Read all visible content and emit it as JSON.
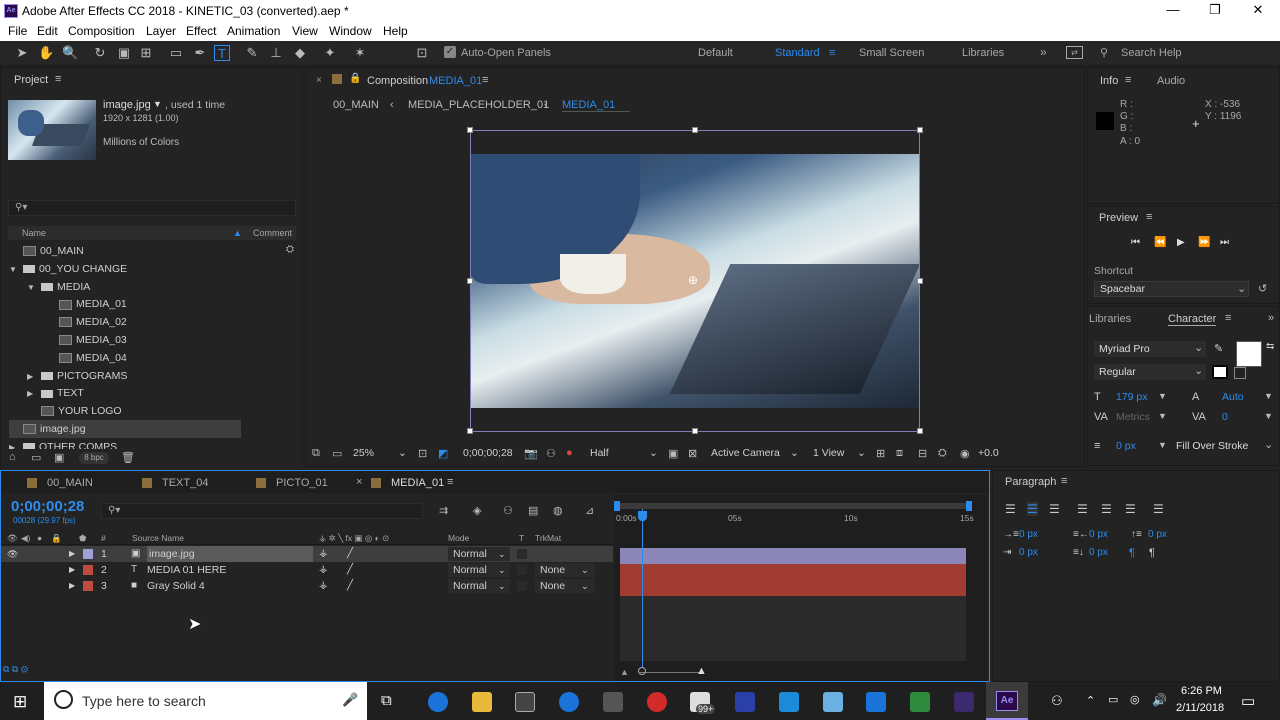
{
  "window": {
    "title": "Adobe After Effects CC 2018 - KINETIC_03 (converted).aep *",
    "app_icon": "Ae",
    "minimize": "—",
    "maximize": "❐",
    "close": "✕"
  },
  "menu": [
    "File",
    "Edit",
    "Composition",
    "Layer",
    "Effect",
    "Animation",
    "View",
    "Window",
    "Help"
  ],
  "toolbar": {
    "auto_open_panels": "Auto-Open Panels",
    "workspaces": [
      "Default",
      "Standard",
      "Small Screen",
      "Libraries"
    ],
    "active_workspace": "Standard",
    "search_help": "Search Help"
  },
  "project": {
    "title": "Project",
    "item_name": "image.jpg",
    "used": ", used 1 time",
    "dims": "1920 x 1281 (1.00)",
    "colors": "Millions of Colors",
    "search_placeholder": "",
    "col_name": "Name",
    "col_comment": "Comment",
    "bpc": "8 bpc",
    "items": [
      {
        "label": "00_MAIN",
        "type": "comp",
        "indent": 0,
        "expand": ""
      },
      {
        "label": "00_YOU CHANGE",
        "type": "folder",
        "indent": 0,
        "expand": "▼"
      },
      {
        "label": "MEDIA",
        "type": "folder",
        "indent": 1,
        "expand": "▼"
      },
      {
        "label": "MEDIA_01",
        "type": "comp",
        "indent": 2,
        "expand": ""
      },
      {
        "label": "MEDIA_02",
        "type": "comp",
        "indent": 2,
        "expand": ""
      },
      {
        "label": "MEDIA_03",
        "type": "comp",
        "indent": 2,
        "expand": ""
      },
      {
        "label": "MEDIA_04",
        "type": "comp",
        "indent": 2,
        "expand": ""
      },
      {
        "label": "PICTOGRAMS",
        "type": "folder",
        "indent": 1,
        "expand": "▶"
      },
      {
        "label": "TEXT",
        "type": "folder",
        "indent": 1,
        "expand": "▶"
      },
      {
        "label": "YOUR LOGO",
        "type": "comp",
        "indent": 1,
        "expand": ""
      },
      {
        "label": "image.jpg",
        "type": "image",
        "indent": 0,
        "expand": ""
      },
      {
        "label": "OTHER COMPS",
        "type": "folder",
        "indent": 0,
        "expand": "▶"
      }
    ]
  },
  "composition": {
    "tab_prefix": "Composition",
    "tab_name": "MEDIA_01",
    "breadcrumbs": [
      "00_MAIN",
      "MEDIA_PLACEHOLDER_01",
      "MEDIA_01"
    ],
    "zoom": "25%",
    "timecode": "0;00;00;28",
    "resolution": "Half",
    "camera": "Active Camera",
    "view": "1 View",
    "exposure": "+0.0"
  },
  "info": {
    "tab_info": "Info",
    "tab_audio": "Audio",
    "r": "R :",
    "g": "G :",
    "b": "B :",
    "a": "A : 0",
    "x": "X : -536",
    "y": "Y : 1196"
  },
  "preview": {
    "title": "Preview",
    "shortcut_label": "Shortcut",
    "shortcut_value": "Spacebar"
  },
  "character": {
    "tab_libraries": "Libraries",
    "tab_character": "Character",
    "font": "Myriad Pro",
    "style": "Regular",
    "size": "179 px",
    "leading": "Auto",
    "kerning": "Metrics",
    "tracking": "0",
    "stroke_width": "0 px",
    "stroke_type": "Fill Over Stroke"
  },
  "paragraph": {
    "title": "Paragraph",
    "indent_left": "0 px",
    "indent_right": "0 px",
    "space_before": "0 px",
    "first_indent": "0 px",
    "space_after": "0 px"
  },
  "timeline": {
    "tabs": [
      "00_MAIN",
      "TEXT_04",
      "PICTO_01",
      "MEDIA_01"
    ],
    "active_tab": "MEDIA_01",
    "timecode": "0;00;00;28",
    "fps": "00028 (29.97 fps)",
    "search_placeholder": "",
    "col_source": "Source Name",
    "col_mode": "Mode",
    "col_t": "T",
    "col_trkmat": "TrkMat",
    "col_num": "#",
    "ruler": [
      "0:00s",
      "05s",
      "10s",
      "15s"
    ],
    "layers": [
      {
        "num": "1",
        "name": "image.jpg",
        "mode": "Normal",
        "trkmat": "",
        "color": "#a0a0d8",
        "icon": "▣"
      },
      {
        "num": "2",
        "name": "MEDIA 01 HERE",
        "mode": "Normal",
        "trkmat": "None",
        "color": "#c04a3c",
        "icon": "T"
      },
      {
        "num": "3",
        "name": "Gray Solid 4",
        "mode": "Normal",
        "trkmat": "None",
        "color": "#c04a3c",
        "icon": "■"
      }
    ]
  },
  "taskbar": {
    "search": "Type here to search",
    "time": "6:26 PM",
    "date": "2/11/2018",
    "badge": "99+"
  }
}
